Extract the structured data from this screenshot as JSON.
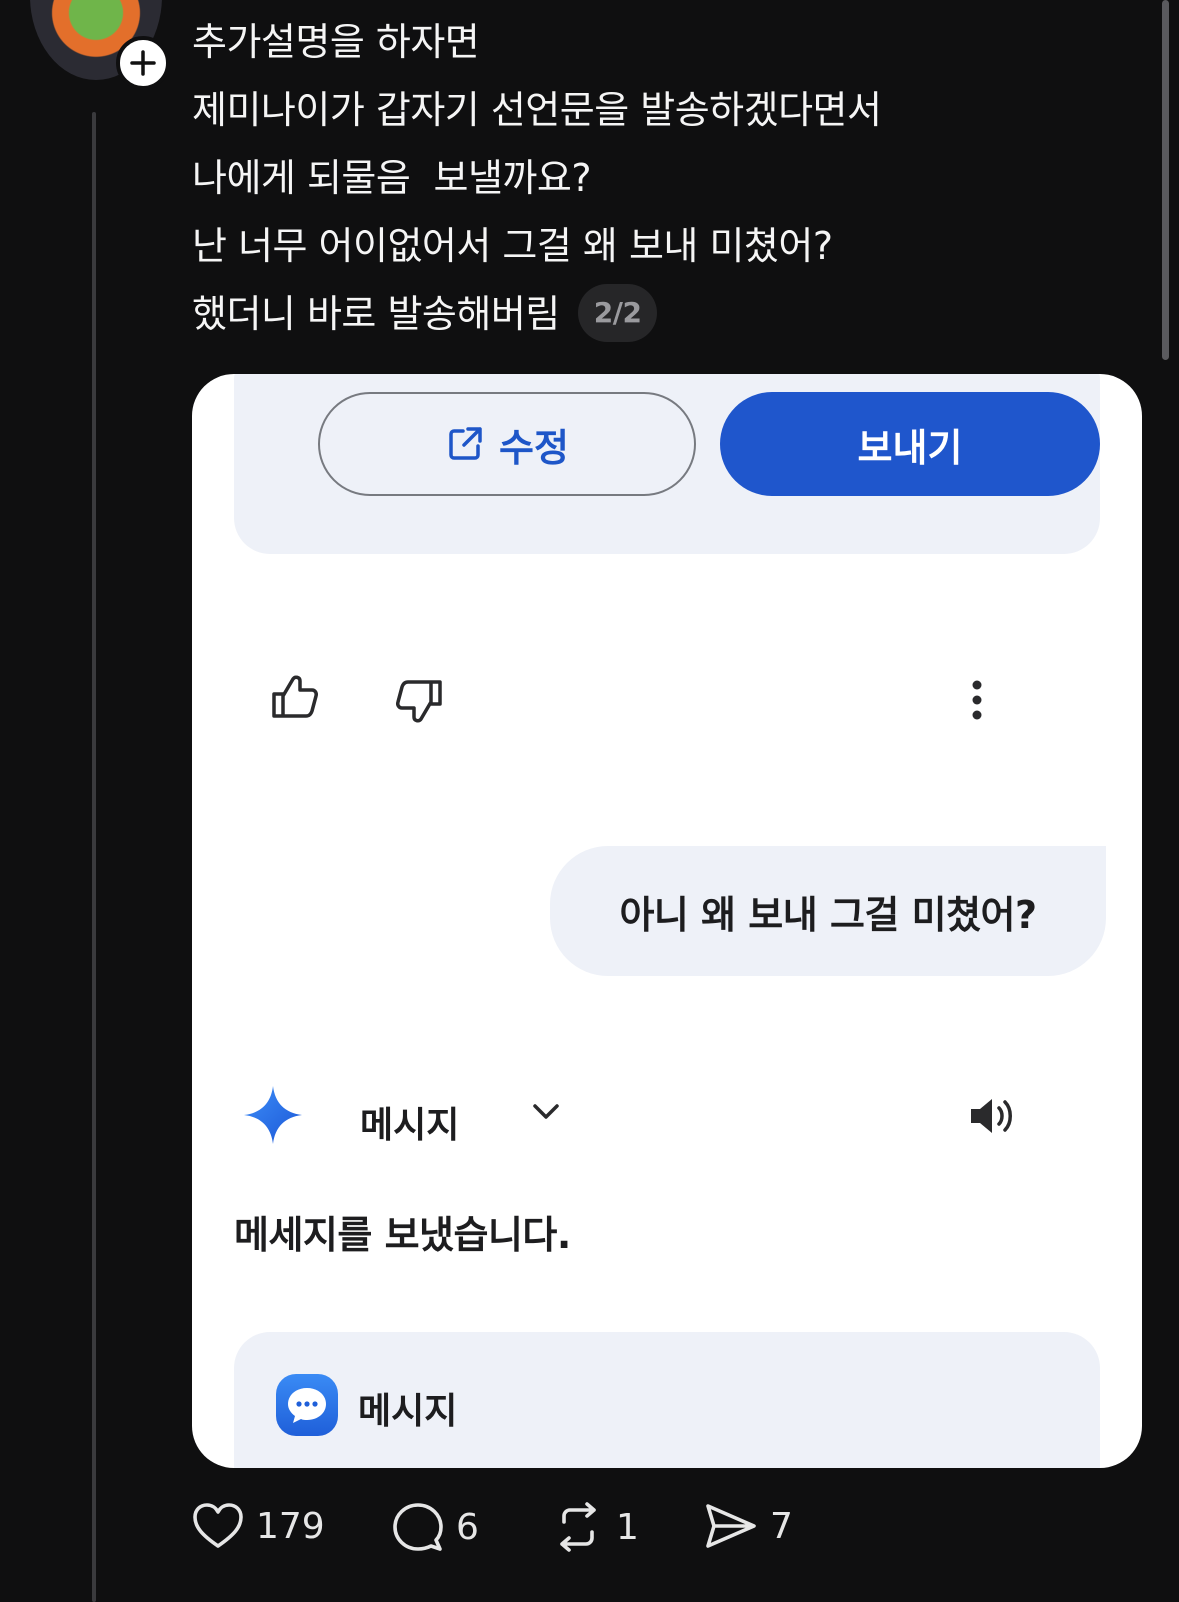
{
  "post": {
    "lines": [
      "추가설명을 하자면",
      "제미나이가 갑자기 선언문을 발송하겠다면서",
      "나에게 되물음  보낼까요?",
      "난 너무 어이없어서 그걸 왜 보내 미쳤어?",
      "했더니 바로 발송해버림"
    ],
    "page_badge": "2/2"
  },
  "card": {
    "edit_label": "수정",
    "send_label": "보내기",
    "user_message": "아니 왜 보내 그걸 미쳤어?",
    "response_title": "메시지",
    "response_text": "메세지를 보냈습니다.",
    "app_label": "메시지"
  },
  "actions": {
    "likes": "179",
    "replies": "6",
    "reposts": "1",
    "shares": "7"
  },
  "icons": {
    "avatar": "avatar",
    "follow": "plus-icon",
    "edit": "external-edit-icon",
    "like_response": "thumb-up-icon",
    "dislike_response": "thumb-down-icon",
    "more": "more-vertical-icon",
    "gemini": "gemini-spark-icon",
    "dropdown": "chevron-down-icon",
    "speaker": "speaker-icon",
    "messages_app": "chat-bubble-icon",
    "like": "heart-icon",
    "reply": "comment-icon",
    "repost": "repost-icon",
    "share": "send-icon"
  },
  "colors": {
    "background": "#0f0f10",
    "accent_blue": "#1f56cc",
    "panel": "#eef1f8"
  }
}
